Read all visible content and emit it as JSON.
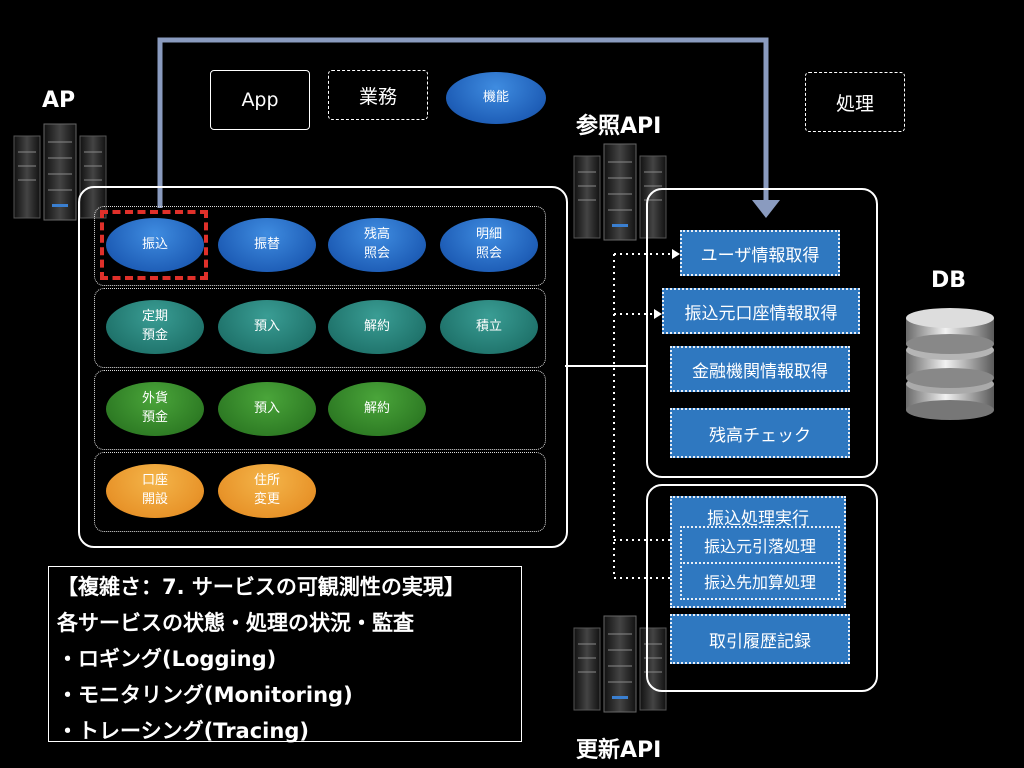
{
  "labels": {
    "ap": "AP",
    "ref_api": "参照API",
    "upd_api": "更新API",
    "db": "DB"
  },
  "legend": {
    "app": "App",
    "gyomu": "業務",
    "kinou": "機能",
    "shori": "処理"
  },
  "rows": [
    {
      "color": "blue",
      "items": [
        "振込",
        "振替",
        "残高\n照会",
        "明細\n照会"
      ]
    },
    {
      "color": "teal",
      "items": [
        "定期\n預金",
        "預入",
        "解約",
        "積立"
      ]
    },
    {
      "color": "green",
      "items": [
        "外貨\n預金",
        "預入",
        "解約"
      ]
    },
    {
      "color": "orange",
      "items": [
        "口座\n開設",
        "住所\n変更"
      ]
    }
  ],
  "ref_api_items": [
    "ユーザ情報取得",
    "振込元口座情報取得",
    "金融機関情報取得",
    "残高チェック"
  ],
  "upd_api": {
    "group_title": "振込処理実行",
    "group_items": [
      "振込元引落処理",
      "振込先加算処理"
    ],
    "single": "取引履歴記録"
  },
  "info": {
    "line1": "【複雑さ：7. サービスの可観測性の実現】",
    "line2": "各サービスの状態・処理の状況・監査",
    "line3": "・ロギング(Logging)",
    "line4": "・モニタリング(Monitoring)",
    "line5": "・トレーシング(Tracing)"
  },
  "colors": {
    "highlight": "#e0302a",
    "arrow": "#8a9bbf",
    "api_box": "#2f78c0"
  }
}
